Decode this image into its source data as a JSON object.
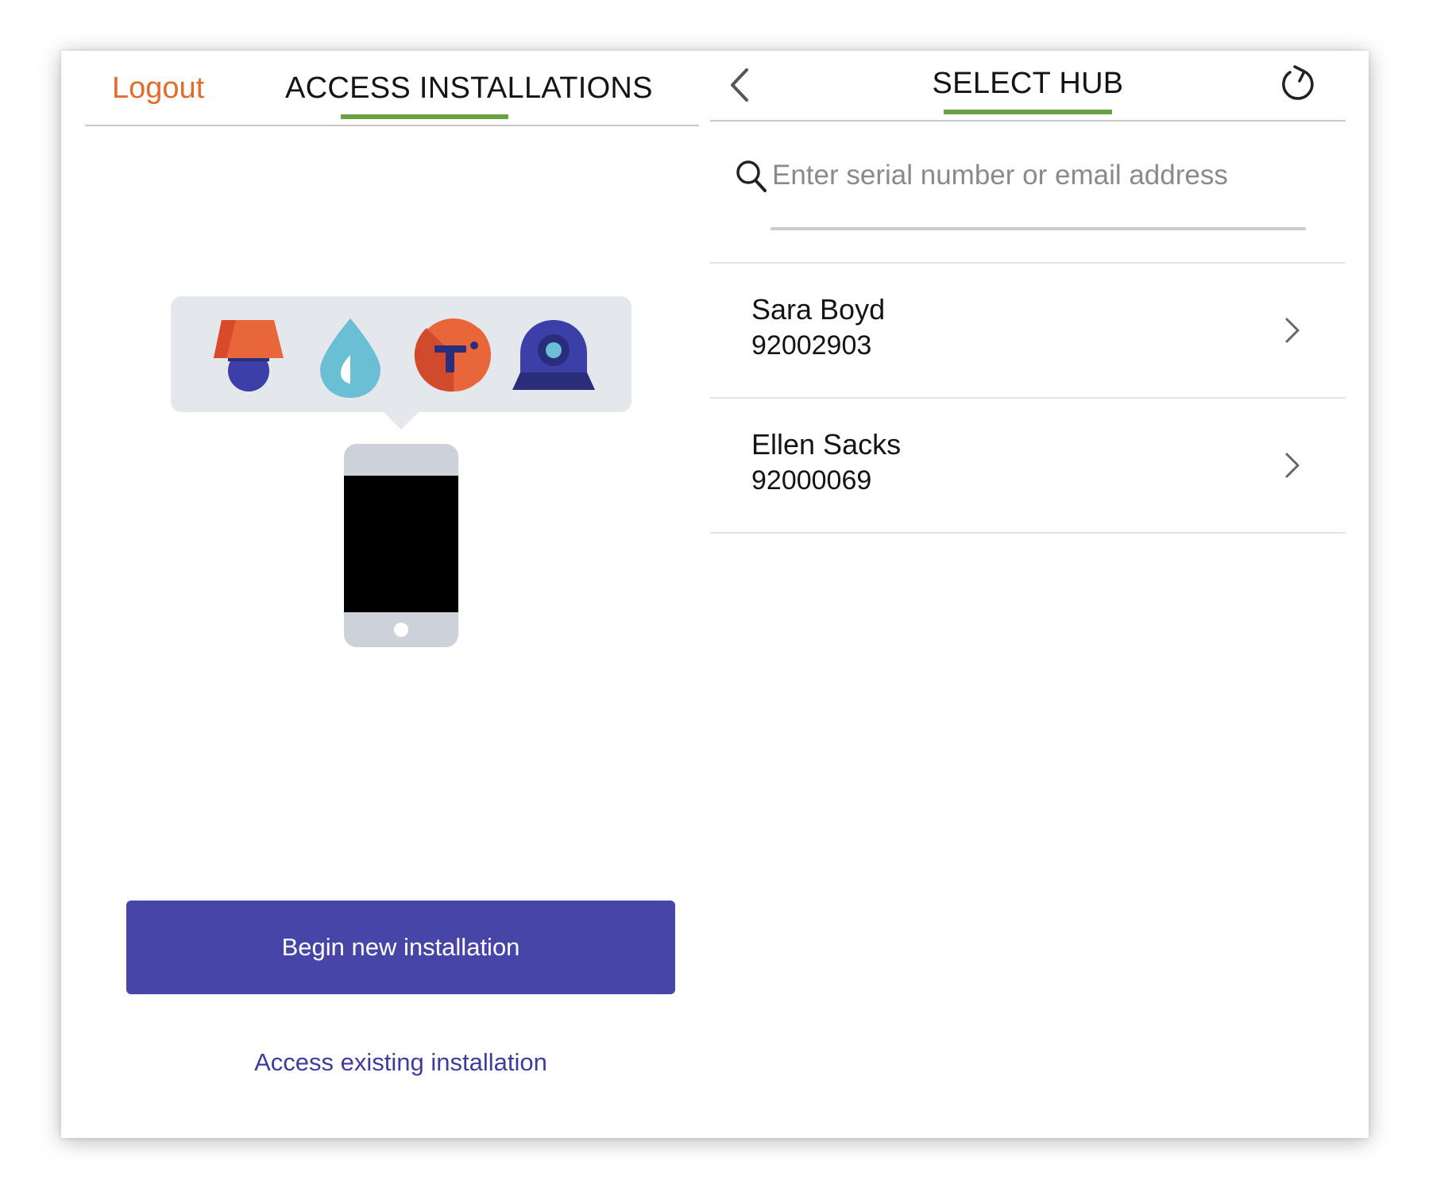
{
  "left_panel": {
    "logout_label": "Logout",
    "title": "ACCESS INSTALLATIONS",
    "primary_button_label": "Begin new installation",
    "secondary_link_label": "Access existing installation"
  },
  "right_panel": {
    "title": "SELECT HUB",
    "search": {
      "placeholder": "Enter serial number or email address",
      "value": ""
    },
    "hubs": [
      {
        "name": "Sara Boyd",
        "serial": "92002903"
      },
      {
        "name": "Ellen Sacks",
        "serial": "92000069"
      }
    ]
  },
  "icons": {
    "back": "chevron-left-icon",
    "refresh": "refresh-icon",
    "search": "search-icon",
    "row_chevron": "chevron-right-icon",
    "illustration": [
      "lamp-icon",
      "water-drop-icon",
      "telstra-logo-icon",
      "camera-icon",
      "smartphone-icon"
    ]
  },
  "colors": {
    "accent_orange": "#e66a2c",
    "accent_green": "#6aa142",
    "primary_purple": "#4745a8",
    "link_purple": "#403c9d",
    "icon_blue": "#6bbfd4",
    "icon_navy": "#3c3fa8"
  }
}
